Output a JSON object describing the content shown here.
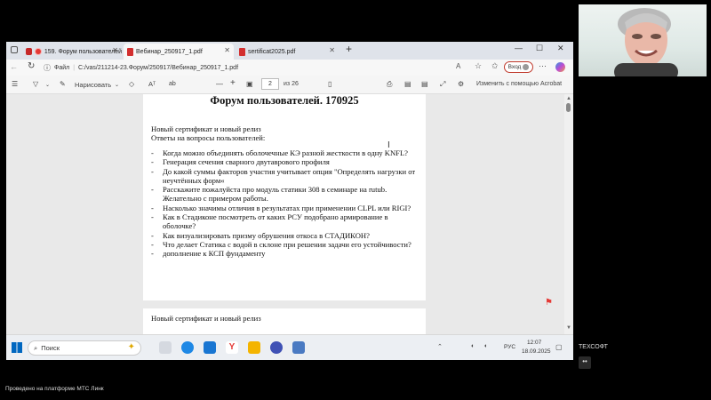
{
  "tabs": [
    {
      "label": "159. Форум пользователей"
    },
    {
      "label": "Вебинар_250917_1.pdf"
    },
    {
      "label": "sertificat2025.pdf"
    }
  ],
  "address": {
    "prefix": "Файл",
    "url": "C:/vas/211214-23.Форум/250917/Вебинар_250917_1.pdf",
    "login": "Вход"
  },
  "pdf_toolbar": {
    "draw": "Нарисовать",
    "page": "2",
    "of_pages": "из 26",
    "edit_acrobat": "Изменить с помощью Acrobat"
  },
  "document": {
    "title": "Форум пользователей. 170925",
    "heading": "Новый сертификат и новый релиз",
    "subheading": "Ответы на вопросы пользователей:",
    "items": [
      "Когда можно объединять оболочечные КЭ разной жесткости в одну KNFL?",
      "Генерация сечения сварного двутаврового профиля",
      "До какой суммы факторов участия учитывает опция \"Определять нагрузки от неучтённых форм«",
      "Расскажите пожалуйста про модуль статики 308 в семинаре на rutub. Желательно с примером работы.",
      "Насколько значимы отличия в результатах при применении CLPL или RIGI?",
      "Как в Стадиконе посмотреть от каких РСУ подобрано армирование в оболочке?",
      "Как визуализировать призму обрушения откоса в СТАДИКОН?",
      "Что делает Статика с водой в склоне при решении задачи его устойчивости?",
      "дополнение к КСП фундаменту"
    ],
    "page2_heading": "Новый сертификат и новый релиз"
  },
  "taskbar": {
    "search": "Поиск",
    "lang": "РУС",
    "time": "12:07",
    "date": "18.09.2025"
  },
  "side": {
    "participant": "ТЕХСОФТ",
    "more": "••"
  },
  "caption": "Проведено на платформе МТС Линк",
  "colors": {
    "pdf_red": "#d32f2f",
    "accent": "#0067c0"
  }
}
